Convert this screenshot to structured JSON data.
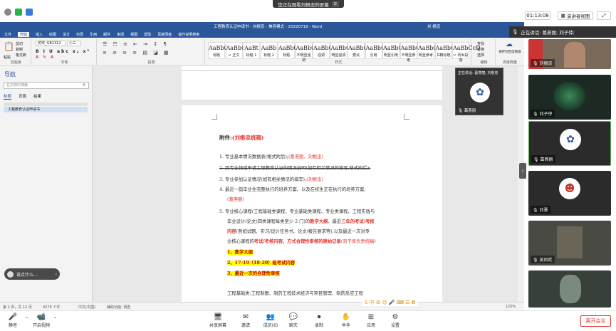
{
  "meeting": {
    "share_banner": "您正在观看刘根忠的屏幕",
    "timer": "01:13:08",
    "view_mode": "演讲者视图",
    "speaking_label": "正在讲话: 葛燕丽; 刘子倖;",
    "leave_button": "离开会议"
  },
  "word": {
    "title": "工程教育认证申请书 - 刘根忠 - 兼容模式 - 20220718 - Word",
    "user": "刘 根忠",
    "menu": [
      "文件",
      "开始",
      "插入",
      "绘图",
      "设计",
      "布局",
      "引用",
      "邮件",
      "审阅",
      "视图",
      "帮助",
      "百度网盘",
      "操作说明搜索"
    ],
    "active_menu": "开始",
    "font_name": "仿宋_GB2312",
    "font_size": "小三",
    "styles": [
      {
        "preview": "AaBbC",
        "name": "标题"
      },
      {
        "preview": "AaBbCcD",
        "name": "↵ 正文"
      },
      {
        "preview": "AaBt",
        "name": "标题 1"
      },
      {
        "preview": "AaBb",
        "name": "标题 2"
      },
      {
        "preview": "AaBbC",
        "name": "标题"
      },
      {
        "preview": "AaBbCcD",
        "name": "不明显强调"
      },
      {
        "preview": "AaBbCcD",
        "name": "强调"
      },
      {
        "preview": "AaBbCcD",
        "name": "明显强调"
      },
      {
        "preview": "AaBbCcD",
        "name": "要点"
      },
      {
        "preview": "AaBbCcD",
        "name": "引用"
      },
      {
        "preview": "AaBbCcD",
        "name": "明显引用"
      },
      {
        "preview": "AaBbCcD",
        "name": "不明显参考"
      },
      {
        "preview": "AaBbCcD",
        "name": "明显参考"
      },
      {
        "preview": "AaBbCcD",
        "name": "书籍标题"
      },
      {
        "preview": "AaBbCcD",
        "name": "↵ 列出段落"
      }
    ],
    "ribbon_groups": [
      "剪贴板",
      "字体",
      "段落",
      "样式",
      "编辑",
      "保存",
      "百度网盘"
    ],
    "right_tools": [
      "查找",
      "替换",
      "选择",
      "保存到百度网盘"
    ],
    "clipboard": {
      "paste": "粘贴",
      "cut": "剪切",
      "copy": "复制",
      "format": "格式刷"
    },
    "nav": {
      "title": "导航",
      "search_placeholder": "在文档中搜索",
      "tabs": [
        "标题",
        "页面",
        "结果"
      ],
      "item": "工程教育认证申请书"
    },
    "status": {
      "page": "第 2 页，共 12 页",
      "words": "4276 个字",
      "lang": "中文(中国)",
      "access": "辅助功能: 调查",
      "zoom": "120%"
    }
  },
  "document": {
    "heading_prefix": "附件:",
    "heading_red": "(刘根忠统稿)",
    "items": [
      {
        "n": "1.",
        "text": "专业基本情况数据表(格式附后);",
        "red": "(葛燕丽、刘根忠)",
        "strike": false
      },
      {
        "n": "2.",
        "text": "跨专业领域申请工程教育认证的情况说明(如有相关情况的填写,格式附后);",
        "red": "",
        "strike": true
      },
      {
        "n": "3.",
        "text": "专业参加认证情况(如有相关情况的填写);",
        "red": "(刘根忠)",
        "strike": false
      },
      {
        "n": "4.",
        "text": "最近一届毕业生完整执行的培养方案、以及在校生正在执行的培养方案;",
        "red": "",
        "strike": false
      }
    ],
    "item4_cont": "(葛燕丽)",
    "item5_lines": [
      "专业核心课程(工程基础类课程、专业基础类课程、专业类课程、工程实践与",
      "毕业设计(论文)四类课程每类至少 2 门)的",
      "(例如试题、实习/设计任务书、论文/报告要求等),以及最近一次对专",
      "业核心课程的"
    ],
    "item5_n": "5.",
    "item5_red1": "教学大纲",
    "item5_mid1": "、最近",
    "item5_red2": "三年的考试/考核",
    "item5_red3": "内容",
    "item5_red4": "考试/考核内容、方式合理性审核的原始记录",
    "item5_red5": "(刘子倖负责统稿)",
    "highlights": [
      "1、教学大纲",
      "2、17-19（18-20）级考试内容",
      "3、最近一次的合理性审核"
    ],
    "last_line": "工程基础类:工程制图、制药工程技术经济与项目管理、制药反应工程"
  },
  "participants": [
    {
      "name": "刘根忠",
      "kind": "video"
    },
    {
      "name": "刘子倖",
      "kind": "video"
    },
    {
      "name": "葛燕丽",
      "kind": "avatar"
    },
    {
      "name": "刘慧",
      "kind": "avatar"
    },
    {
      "name": "吴凤欢",
      "kind": "video"
    },
    {
      "name": "",
      "kind": "video"
    }
  ],
  "mini_tile": {
    "label": "正在讲话: 葛燕丽; 刘根忠",
    "name": "葛燕丽"
  },
  "toolbar": [
    {
      "icon": "🎤",
      "label": "静音"
    },
    {
      "icon": "📹",
      "label": "开启视频"
    },
    {
      "icon": "🖥",
      "label": "共享屏幕"
    },
    {
      "icon": "✉",
      "label": "邀请"
    },
    {
      "icon": "👥",
      "label": "成员(6)"
    },
    {
      "icon": "💬",
      "label": "聊天"
    },
    {
      "icon": "⏺",
      "label": "录制"
    },
    {
      "icon": "✋",
      "label": "举手"
    },
    {
      "icon": "⊞",
      "label": "应用"
    },
    {
      "icon": "⚙",
      "label": "设置"
    }
  ],
  "colors": {
    "word_blue": "#2b579a",
    "red": "#e0352b",
    "highlight": "#ffff00"
  }
}
